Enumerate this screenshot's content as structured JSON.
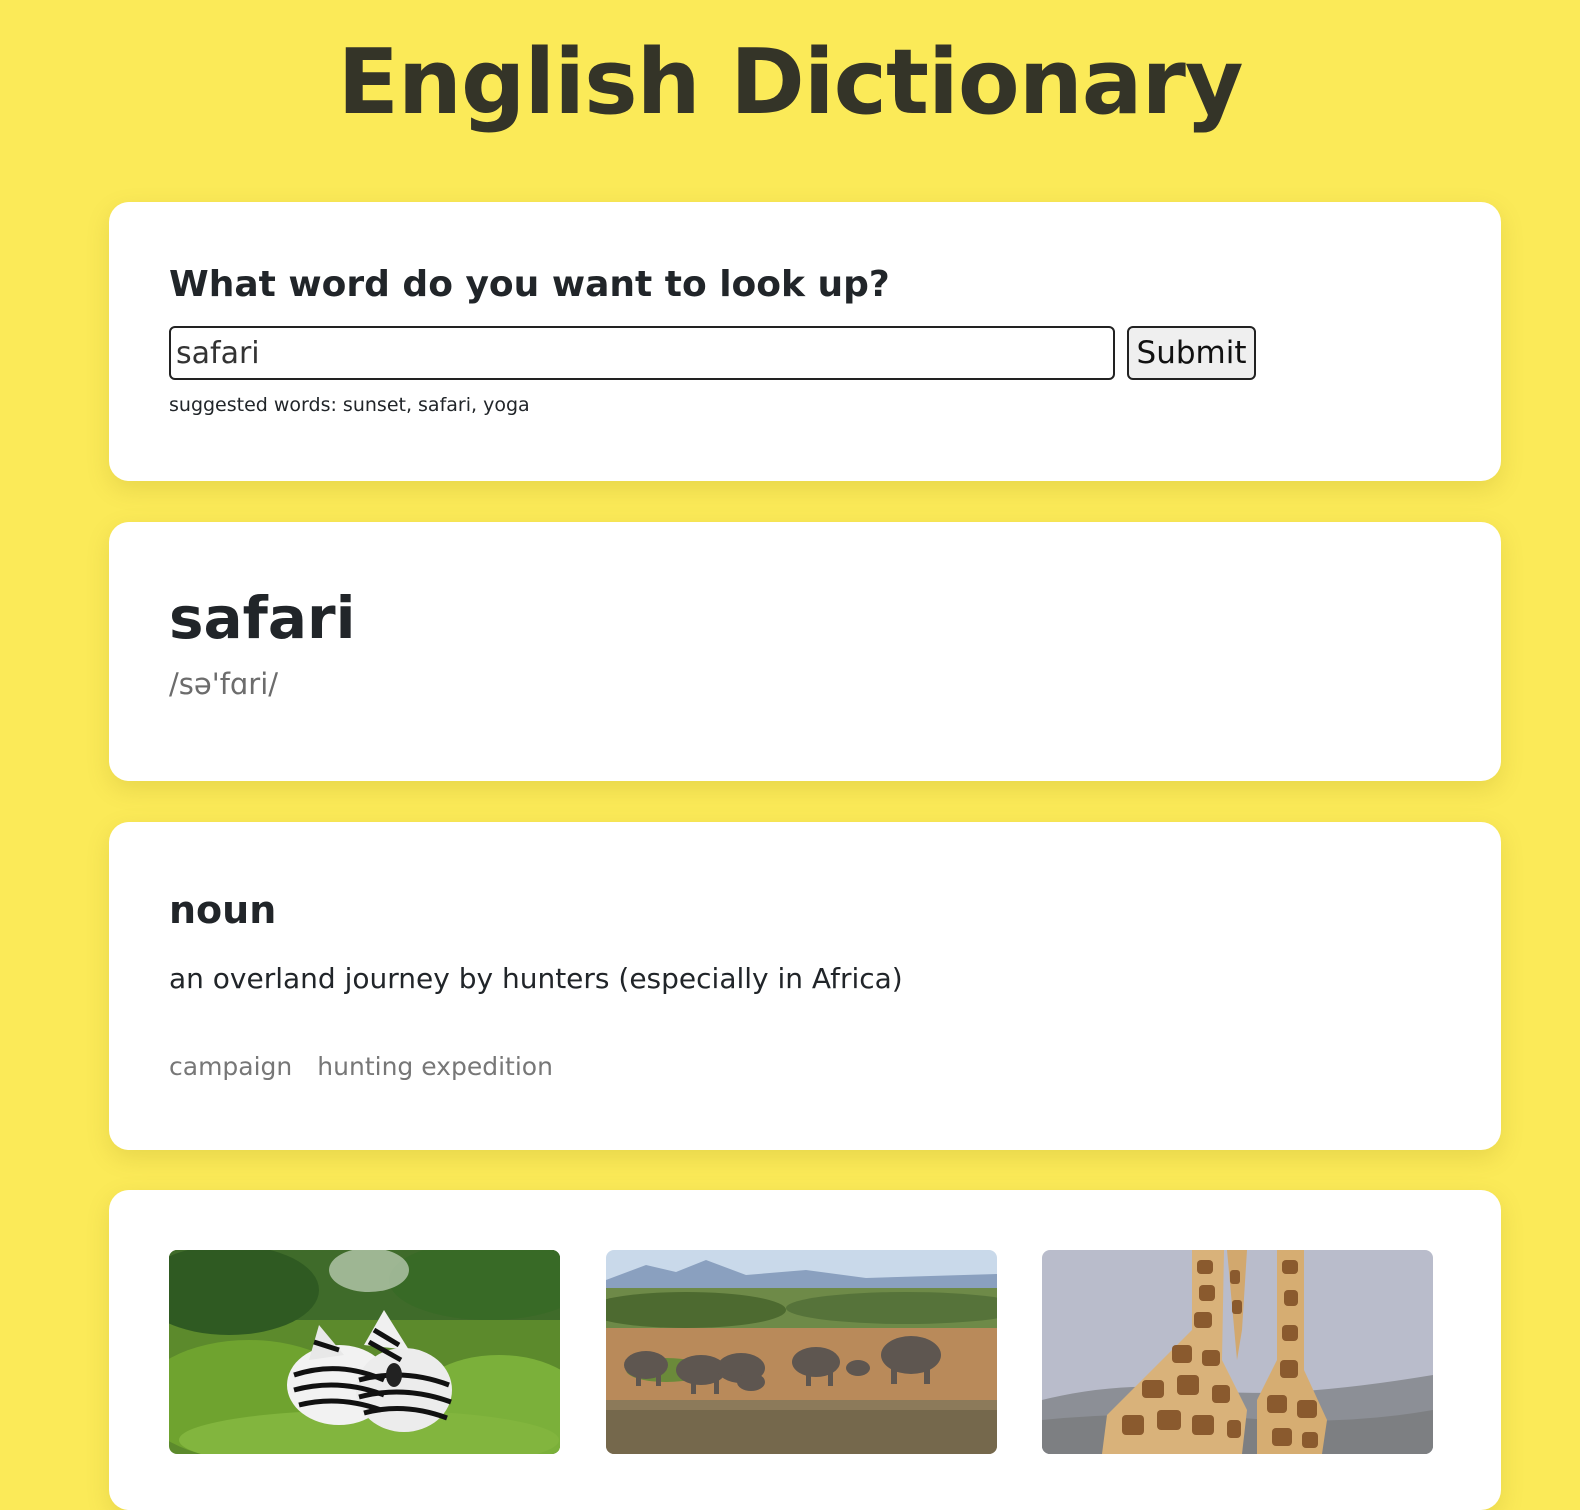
{
  "app": {
    "title": "English Dictionary"
  },
  "search": {
    "heading": "What word do you want to look up?",
    "value": "safari",
    "submit_label": "Submit",
    "suggestions": "suggested words: sunset, safari, yoga"
  },
  "result": {
    "word": "safari",
    "phonetic": "/sə'fɑri/"
  },
  "meaning": {
    "part_of_speech": "noun",
    "definition": "an overland journey by hunters (especially in Africa)",
    "synonyms": [
      "campaign",
      "hunting expedition"
    ]
  },
  "photos": [
    {
      "icon": "zebras-photo"
    },
    {
      "icon": "elephants-photo"
    },
    {
      "icon": "giraffes-photo"
    }
  ],
  "colors": {
    "background": "#fbea58",
    "card": "#ffffff",
    "title": "#343428",
    "muted": "#777777"
  }
}
